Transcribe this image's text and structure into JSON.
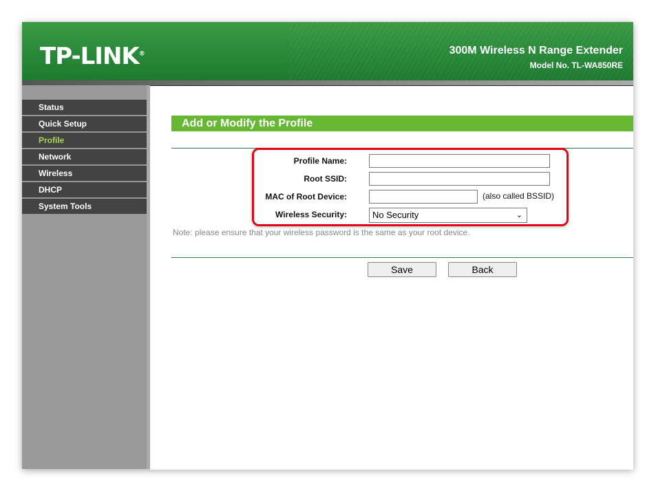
{
  "header": {
    "logo": "TP-LINK",
    "logo_mark": "®",
    "product": "300M Wireless N Range Extender",
    "model": "Model No. TL-WA850RE"
  },
  "sidebar": {
    "items": [
      {
        "label": "Status"
      },
      {
        "label": "Quick Setup"
      },
      {
        "label": "Profile",
        "active": true
      },
      {
        "label": "Network"
      },
      {
        "label": "Wireless"
      },
      {
        "label": "DHCP"
      },
      {
        "label": "System Tools"
      }
    ]
  },
  "main": {
    "title": "Add or Modify the Profile",
    "form": {
      "profile_name": {
        "label": "Profile Name:",
        "value": ""
      },
      "root_ssid": {
        "label": "Root SSID:",
        "value": ""
      },
      "mac": {
        "label": "MAC of Root Device:",
        "value": "",
        "hint": "(also called BSSID)"
      },
      "security": {
        "label": "Wireless Security:",
        "value": "No Security"
      }
    },
    "note": "Note: please ensure that your wireless password is the same as your root device.",
    "save_label": "Save",
    "back_label": "Back"
  },
  "colors": {
    "header_green": "#2a8a3a",
    "title_green": "#66b732",
    "active_nav": "#a8d94a",
    "highlight": "#e30613"
  }
}
